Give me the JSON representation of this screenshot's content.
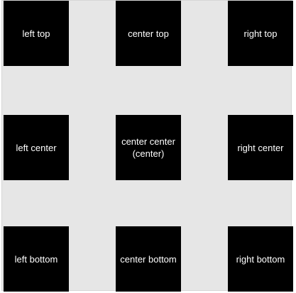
{
  "grid": {
    "background_color": "#e6e6e6",
    "box_color": "#000000",
    "text_color": "#ffffff",
    "cells": {
      "left_top": {
        "label": "left top"
      },
      "center_top": {
        "label": "center top"
      },
      "right_top": {
        "label": "right top"
      },
      "left_center": {
        "label": "left center"
      },
      "center_center": {
        "label": "center center",
        "sublabel": "(center)"
      },
      "right_center": {
        "label": "right center"
      },
      "left_bottom": {
        "label": "left bottom"
      },
      "center_bottom": {
        "label": "center bottom"
      },
      "right_bottom": {
        "label": "right bottom"
      }
    }
  }
}
